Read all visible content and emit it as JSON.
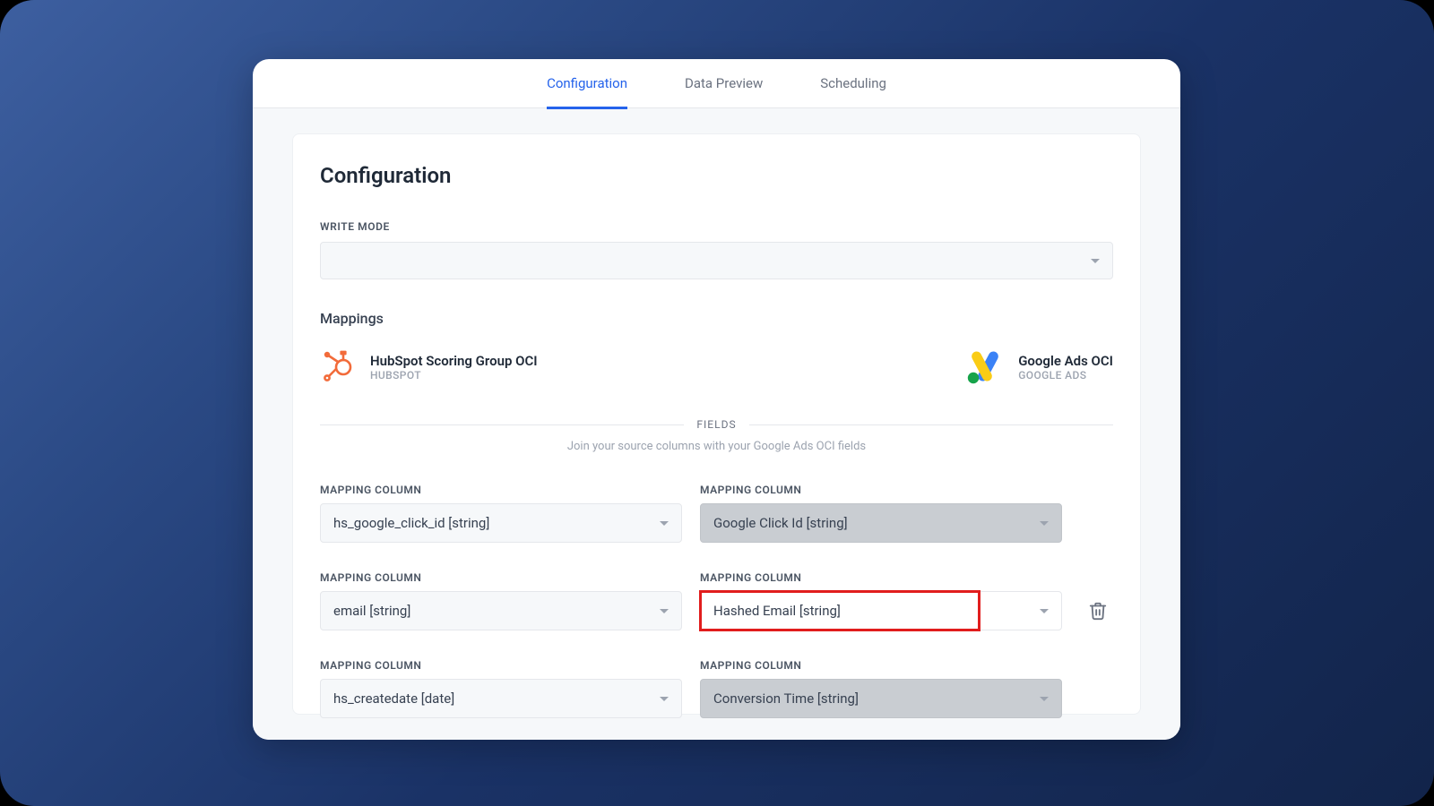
{
  "tabs": {
    "configuration": "Configuration",
    "data_preview": "Data Preview",
    "scheduling": "Scheduling"
  },
  "page": {
    "title": "Configuration",
    "write_mode_label": "WRITE MODE",
    "write_mode_value": "",
    "mappings_heading": "Mappings"
  },
  "source": {
    "name": "HubSpot Scoring Group OCI",
    "provider": "HUBSPOT"
  },
  "destination": {
    "name": "Google Ads OCI",
    "provider": "GOOGLE ADS"
  },
  "fields": {
    "divider": "FIELDS",
    "subtitle": "Join your source columns with your Google Ads OCI fields",
    "column_label": "MAPPING COLUMN"
  },
  "rows": [
    {
      "source": "hs_google_click_id [string]",
      "dest": "Google Click Id [string]",
      "dest_locked": true,
      "highlight": false,
      "deletable": false
    },
    {
      "source": "email [string]",
      "dest": "Hashed Email [string]",
      "dest_locked": false,
      "highlight": true,
      "deletable": true
    },
    {
      "source": "hs_createdate [date]",
      "dest": "Conversion Time [string]",
      "dest_locked": true,
      "highlight": false,
      "deletable": false
    }
  ]
}
